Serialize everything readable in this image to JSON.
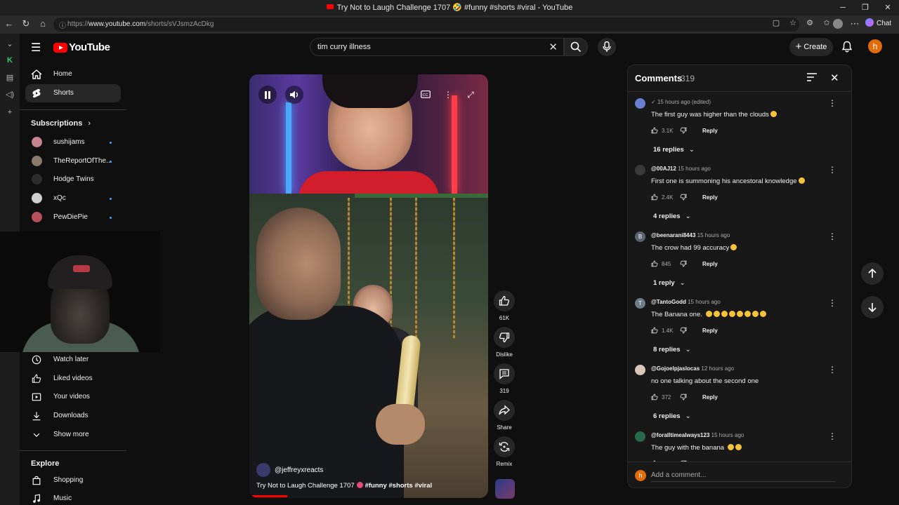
{
  "browser": {
    "window_title": "Try Not to Laugh Challenge 1707 🤣 #funny #shorts #viral - YouTube",
    "url_prefix": "https://",
    "url_domain": "www.youtube.com",
    "url_path": "/shorts/sVJsmzAcDkg",
    "chat_label": "Chat"
  },
  "youtube": {
    "logo_text": "YouTube",
    "search_value": "tim curry illness",
    "create_label": "Create",
    "avatar_letter": "h"
  },
  "sidebar": {
    "main": [
      {
        "label": "Home",
        "icon": "home-icon"
      },
      {
        "label": "Shorts",
        "icon": "shorts-icon",
        "active": true
      }
    ],
    "subscriptions_heading": "Subscriptions",
    "subscriptions": [
      {
        "label": "sushijams",
        "color": "#c7848e"
      },
      {
        "label": "TheReportOfThe...",
        "color": "#8a7a6a"
      },
      {
        "label": "Hodge Twins",
        "color": "#2d2d2d"
      },
      {
        "label": "xQc",
        "color": "#cfcfcf"
      },
      {
        "label": "PewDiePie",
        "color": "#b5515a"
      }
    ],
    "you": [
      {
        "label": "Watch later",
        "icon": "clock-icon"
      },
      {
        "label": "Liked videos",
        "icon": "thumbs-up-icon"
      },
      {
        "label": "Your videos",
        "icon": "your-videos-icon"
      },
      {
        "label": "Downloads",
        "icon": "download-icon"
      },
      {
        "label": "Show more",
        "icon": "chevron-down-icon"
      }
    ],
    "explore_heading": "Explore",
    "explore": [
      {
        "label": "Shopping",
        "icon": "shopping-bag-icon"
      },
      {
        "label": "Music",
        "icon": "music-icon"
      }
    ]
  },
  "short": {
    "channel": "@jeffreyxreacts",
    "title_plain": "Try Not to Laugh Challenge 1707",
    "title_tags": "#funny #shorts #viral",
    "likes": "61K",
    "dislike_label": "Dislike",
    "comments_count": "319",
    "share_label": "Share",
    "remix_label": "Remix"
  },
  "comments_panel": {
    "title": "Comments",
    "count": "319",
    "placeholder": "Add a comment...",
    "reply_label": "Reply",
    "items": [
      {
        "author": "",
        "time": "15 hours ago (edited)",
        "text": "The first guy was higher than the clouds",
        "likes": "3.1K",
        "replies": "16 replies",
        "avatar": "",
        "avatar_color": "#6a7fd0"
      },
      {
        "author": "@00AJ12",
        "time": "15 hours ago",
        "text": "First one is summoning his ancestoral knowledge",
        "likes": "2.4K",
        "replies": "4 replies",
        "avatar": "",
        "avatar_color": "#3a3a3a"
      },
      {
        "author": "@beenarani8443",
        "time": "15 hours ago",
        "text": "The crow had 99 accuracy",
        "likes": "845",
        "replies": "1 reply",
        "avatar": "B",
        "avatar_color": "#5a6470"
      },
      {
        "author": "@TantoGodd",
        "time": "15 hours ago",
        "text": "The Banana one.",
        "likes": "1.4K",
        "replies": "8 replies",
        "avatar": "T",
        "avatar_color": "#6d7c86"
      },
      {
        "author": "@Gojoelpjaslocas",
        "time": "12 hours ago",
        "text": "no one talking about the second one",
        "likes": "372",
        "replies": "6 replies",
        "avatar": "",
        "avatar_color": "#d8c6b8"
      },
      {
        "author": "@foralltimealways123",
        "time": "15 hours ago",
        "text": "The guy with the banana",
        "likes": "",
        "replies": "",
        "avatar": "",
        "avatar_color": "#2a6a4a"
      }
    ]
  }
}
